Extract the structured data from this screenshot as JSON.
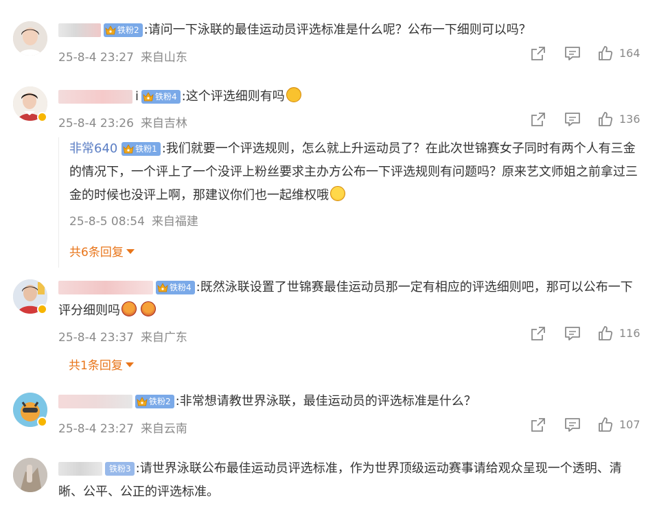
{
  "comments": [
    {
      "badge": "铁粉2",
      "text": ":请问一下泳联的最佳运动员评选标准是什么呢？公布一下细则可以吗？",
      "time": "25-8-4 23:27",
      "location": "来自山东",
      "likes": "164"
    },
    {
      "name_suffix": "i",
      "badge": "铁粉4",
      "text": ":这个评选细则有吗",
      "time": "25-8-4 23:26",
      "location": "来自吉林",
      "likes": "136",
      "reply": {
        "name": "非常640",
        "badge": "铁粉1",
        "text": ":我们就要一个评选规则，怎么就上升运动员了？在此次世锦赛女子同时有两个人有三金的情况下，一个评上了一个没评上粉丝要求主办方公布一下评选规则有问题吗？原来艺文师姐之前拿过三金的时候也没评上啊，那建议你们也一起维权哦",
        "time": "25-8-5 08:54",
        "location": "来自福建"
      },
      "more": "共6条回复"
    },
    {
      "badge": "铁粉4",
      "text": ":既然泳联设置了世锦赛最佳运动员那一定有相应的评选细则吧，那可以公布一下评分细则吗",
      "time": "25-8-4 23:37",
      "location": "来自广东",
      "likes": "116",
      "more": "共1条回复"
    },
    {
      "badge": "铁粉2",
      "text": ":非常想请教世界泳联，最佳运动员的评选标准是什么？",
      "time": "25-8-4 23:27",
      "location": "来自云南",
      "likes": "107"
    },
    {
      "badge": "铁粉3",
      "text": ":请世界泳联公布最佳运动员评选标准，作为世界顶级运动赛事请给观众呈现一个透明、清晰、公平、公正的评选标准。"
    }
  ],
  "icons": {
    "share": "share-icon",
    "comment": "comment-icon",
    "like": "like-icon",
    "crown": "crown-icon"
  }
}
